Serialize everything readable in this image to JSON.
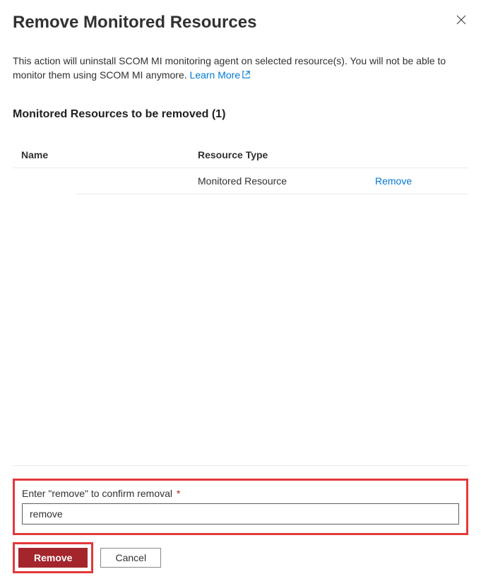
{
  "dialog": {
    "title": "Remove Monitored Resources",
    "description_pre": "This action will uninstall SCOM MI monitoring agent on selected resource(s). You will not be able to monitor them using SCOM MI anymore. ",
    "learn_more": "Learn More"
  },
  "section": {
    "heading": "Monitored Resources to be removed (1)"
  },
  "table": {
    "headers": {
      "name": "Name",
      "type": "Resource Type"
    },
    "rows": [
      {
        "name": "",
        "type": "Monitored Resource",
        "action": "Remove"
      }
    ]
  },
  "confirm": {
    "label": "Enter \"remove\" to confirm removal",
    "required_mark": "*",
    "value": "remove"
  },
  "buttons": {
    "remove": "Remove",
    "cancel": "Cancel"
  }
}
